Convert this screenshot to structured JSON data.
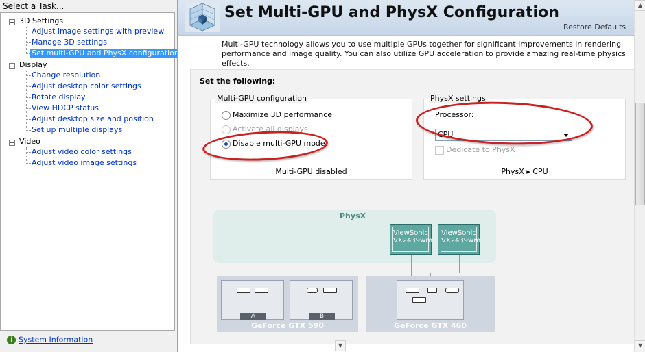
{
  "task_pane": {
    "header": "Select a Task...",
    "categories": [
      {
        "label": "3D Settings",
        "items": [
          "Adjust image settings with preview",
          "Manage 3D settings",
          "Set multi-GPU and PhysX configuration"
        ]
      },
      {
        "label": "Display",
        "items": [
          "Change resolution",
          "Adjust desktop color settings",
          "Rotate display",
          "View HDCP status",
          "Adjust desktop size and position",
          "Set up multiple displays"
        ]
      },
      {
        "label": "Video",
        "items": [
          "Adjust video color settings",
          "Adjust video image settings"
        ]
      }
    ],
    "selected_item": "Set multi-GPU and PhysX configuration",
    "system_info_link": "System Information"
  },
  "page": {
    "title": "Set Multi-GPU and PhysX Configuration",
    "restore_defaults": "Restore Defaults",
    "description": "Multi-GPU technology allows you to use multiple GPUs together for significant improvements in rendering performance and image quality. You can also utilize GPU acceleration to provide amazing real-time physics effects.",
    "set_the_following": "Set the following:"
  },
  "multi_gpu": {
    "title": "Multi-GPU configuration",
    "options": [
      {
        "label": "Maximize 3D performance",
        "checked": false,
        "enabled": true
      },
      {
        "label": "Activate all displays",
        "checked": false,
        "enabled": false
      },
      {
        "label": "Disable multi-GPU mode",
        "checked": true,
        "enabled": true
      }
    ],
    "status": "Multi-GPU disabled"
  },
  "physx": {
    "title": "PhysX settings",
    "processor_label": "Processor:",
    "processor_value": "CPU",
    "dedicate_label": "Dedicate to PhysX",
    "dedicate_checked": false,
    "status": "PhysX ▸ CPU"
  },
  "diagram": {
    "physx_label": "PhysX",
    "monitors": [
      {
        "line1": "ViewSonic",
        "line2": "VX2439wm"
      },
      {
        "line1": "ViewSonic",
        "line2": "VX2439wm"
      }
    ],
    "gpus": [
      {
        "name": "GeForce GTX 590",
        "tags": [
          "A",
          "B"
        ]
      },
      {
        "name": "GeForce GTX 460"
      }
    ]
  },
  "colors": {
    "annotation_red": "#cc1f1f",
    "link_blue": "#0033cc",
    "selection_blue": "#3399ff",
    "monitor_teal": "#5fa7a1",
    "physx_area": "#dfeeea"
  }
}
